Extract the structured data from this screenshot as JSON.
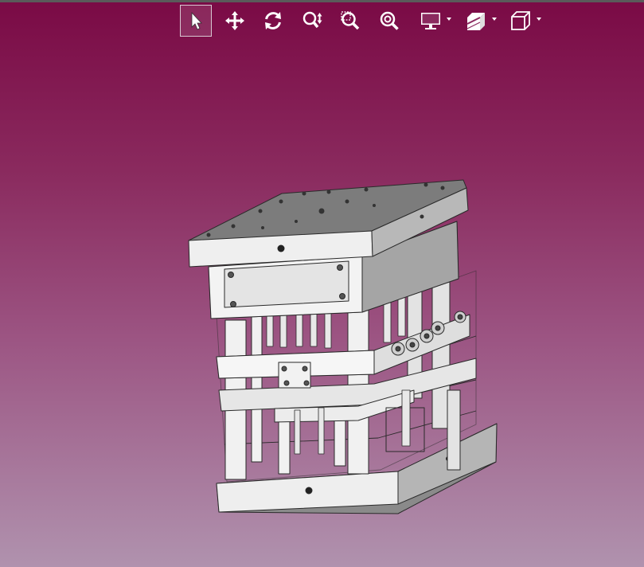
{
  "colors": {
    "background_top": "#7a0a45",
    "background_bottom": "#b092ae",
    "icon": "#ffffff",
    "model_fill": "#eeeeee",
    "model_line": "#2a2a2a"
  },
  "toolbar": {
    "tools": [
      {
        "id": "select",
        "icon": "pointer-icon",
        "active": true,
        "has_dropdown": false
      },
      {
        "id": "pan",
        "icon": "move-icon",
        "active": false,
        "has_dropdown": false
      },
      {
        "id": "rotate",
        "icon": "rotate-icon",
        "active": false,
        "has_dropdown": false
      },
      {
        "id": "zoom",
        "icon": "zoom-updown-icon",
        "active": false,
        "has_dropdown": false
      },
      {
        "id": "zoom-window",
        "icon": "zoom-window-icon",
        "active": false,
        "has_dropdown": false
      },
      {
        "id": "zoom-fit",
        "icon": "zoom-fit-icon",
        "active": false,
        "has_dropdown": false
      },
      {
        "id": "display-mode",
        "icon": "monitor-icon",
        "active": false,
        "has_dropdown": true
      },
      {
        "id": "section-view",
        "icon": "section-icon",
        "active": false,
        "has_dropdown": true
      },
      {
        "id": "standard-views",
        "icon": "cube-icon",
        "active": false,
        "has_dropdown": true
      }
    ]
  },
  "viewport": {
    "model_icon": "injection-mold-assembly"
  }
}
